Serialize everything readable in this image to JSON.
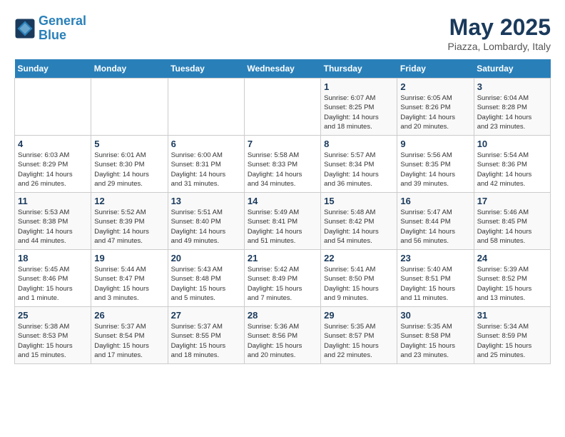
{
  "header": {
    "logo_line1": "General",
    "logo_line2": "Blue",
    "month": "May 2025",
    "location": "Piazza, Lombardy, Italy"
  },
  "days_of_week": [
    "Sunday",
    "Monday",
    "Tuesday",
    "Wednesday",
    "Thursday",
    "Friday",
    "Saturday"
  ],
  "weeks": [
    [
      {
        "num": "",
        "info": ""
      },
      {
        "num": "",
        "info": ""
      },
      {
        "num": "",
        "info": ""
      },
      {
        "num": "",
        "info": ""
      },
      {
        "num": "1",
        "info": "Sunrise: 6:07 AM\nSunset: 8:25 PM\nDaylight: 14 hours\nand 18 minutes."
      },
      {
        "num": "2",
        "info": "Sunrise: 6:05 AM\nSunset: 8:26 PM\nDaylight: 14 hours\nand 20 minutes."
      },
      {
        "num": "3",
        "info": "Sunrise: 6:04 AM\nSunset: 8:28 PM\nDaylight: 14 hours\nand 23 minutes."
      }
    ],
    [
      {
        "num": "4",
        "info": "Sunrise: 6:03 AM\nSunset: 8:29 PM\nDaylight: 14 hours\nand 26 minutes."
      },
      {
        "num": "5",
        "info": "Sunrise: 6:01 AM\nSunset: 8:30 PM\nDaylight: 14 hours\nand 29 minutes."
      },
      {
        "num": "6",
        "info": "Sunrise: 6:00 AM\nSunset: 8:31 PM\nDaylight: 14 hours\nand 31 minutes."
      },
      {
        "num": "7",
        "info": "Sunrise: 5:58 AM\nSunset: 8:33 PM\nDaylight: 14 hours\nand 34 minutes."
      },
      {
        "num": "8",
        "info": "Sunrise: 5:57 AM\nSunset: 8:34 PM\nDaylight: 14 hours\nand 36 minutes."
      },
      {
        "num": "9",
        "info": "Sunrise: 5:56 AM\nSunset: 8:35 PM\nDaylight: 14 hours\nand 39 minutes."
      },
      {
        "num": "10",
        "info": "Sunrise: 5:54 AM\nSunset: 8:36 PM\nDaylight: 14 hours\nand 42 minutes."
      }
    ],
    [
      {
        "num": "11",
        "info": "Sunrise: 5:53 AM\nSunset: 8:38 PM\nDaylight: 14 hours\nand 44 minutes."
      },
      {
        "num": "12",
        "info": "Sunrise: 5:52 AM\nSunset: 8:39 PM\nDaylight: 14 hours\nand 47 minutes."
      },
      {
        "num": "13",
        "info": "Sunrise: 5:51 AM\nSunset: 8:40 PM\nDaylight: 14 hours\nand 49 minutes."
      },
      {
        "num": "14",
        "info": "Sunrise: 5:49 AM\nSunset: 8:41 PM\nDaylight: 14 hours\nand 51 minutes."
      },
      {
        "num": "15",
        "info": "Sunrise: 5:48 AM\nSunset: 8:42 PM\nDaylight: 14 hours\nand 54 minutes."
      },
      {
        "num": "16",
        "info": "Sunrise: 5:47 AM\nSunset: 8:44 PM\nDaylight: 14 hours\nand 56 minutes."
      },
      {
        "num": "17",
        "info": "Sunrise: 5:46 AM\nSunset: 8:45 PM\nDaylight: 14 hours\nand 58 minutes."
      }
    ],
    [
      {
        "num": "18",
        "info": "Sunrise: 5:45 AM\nSunset: 8:46 PM\nDaylight: 15 hours\nand 1 minute."
      },
      {
        "num": "19",
        "info": "Sunrise: 5:44 AM\nSunset: 8:47 PM\nDaylight: 15 hours\nand 3 minutes."
      },
      {
        "num": "20",
        "info": "Sunrise: 5:43 AM\nSunset: 8:48 PM\nDaylight: 15 hours\nand 5 minutes."
      },
      {
        "num": "21",
        "info": "Sunrise: 5:42 AM\nSunset: 8:49 PM\nDaylight: 15 hours\nand 7 minutes."
      },
      {
        "num": "22",
        "info": "Sunrise: 5:41 AM\nSunset: 8:50 PM\nDaylight: 15 hours\nand 9 minutes."
      },
      {
        "num": "23",
        "info": "Sunrise: 5:40 AM\nSunset: 8:51 PM\nDaylight: 15 hours\nand 11 minutes."
      },
      {
        "num": "24",
        "info": "Sunrise: 5:39 AM\nSunset: 8:52 PM\nDaylight: 15 hours\nand 13 minutes."
      }
    ],
    [
      {
        "num": "25",
        "info": "Sunrise: 5:38 AM\nSunset: 8:53 PM\nDaylight: 15 hours\nand 15 minutes."
      },
      {
        "num": "26",
        "info": "Sunrise: 5:37 AM\nSunset: 8:54 PM\nDaylight: 15 hours\nand 17 minutes."
      },
      {
        "num": "27",
        "info": "Sunrise: 5:37 AM\nSunset: 8:55 PM\nDaylight: 15 hours\nand 18 minutes."
      },
      {
        "num": "28",
        "info": "Sunrise: 5:36 AM\nSunset: 8:56 PM\nDaylight: 15 hours\nand 20 minutes."
      },
      {
        "num": "29",
        "info": "Sunrise: 5:35 AM\nSunset: 8:57 PM\nDaylight: 15 hours\nand 22 minutes."
      },
      {
        "num": "30",
        "info": "Sunrise: 5:35 AM\nSunset: 8:58 PM\nDaylight: 15 hours\nand 23 minutes."
      },
      {
        "num": "31",
        "info": "Sunrise: 5:34 AM\nSunset: 8:59 PM\nDaylight: 15 hours\nand 25 minutes."
      }
    ]
  ]
}
